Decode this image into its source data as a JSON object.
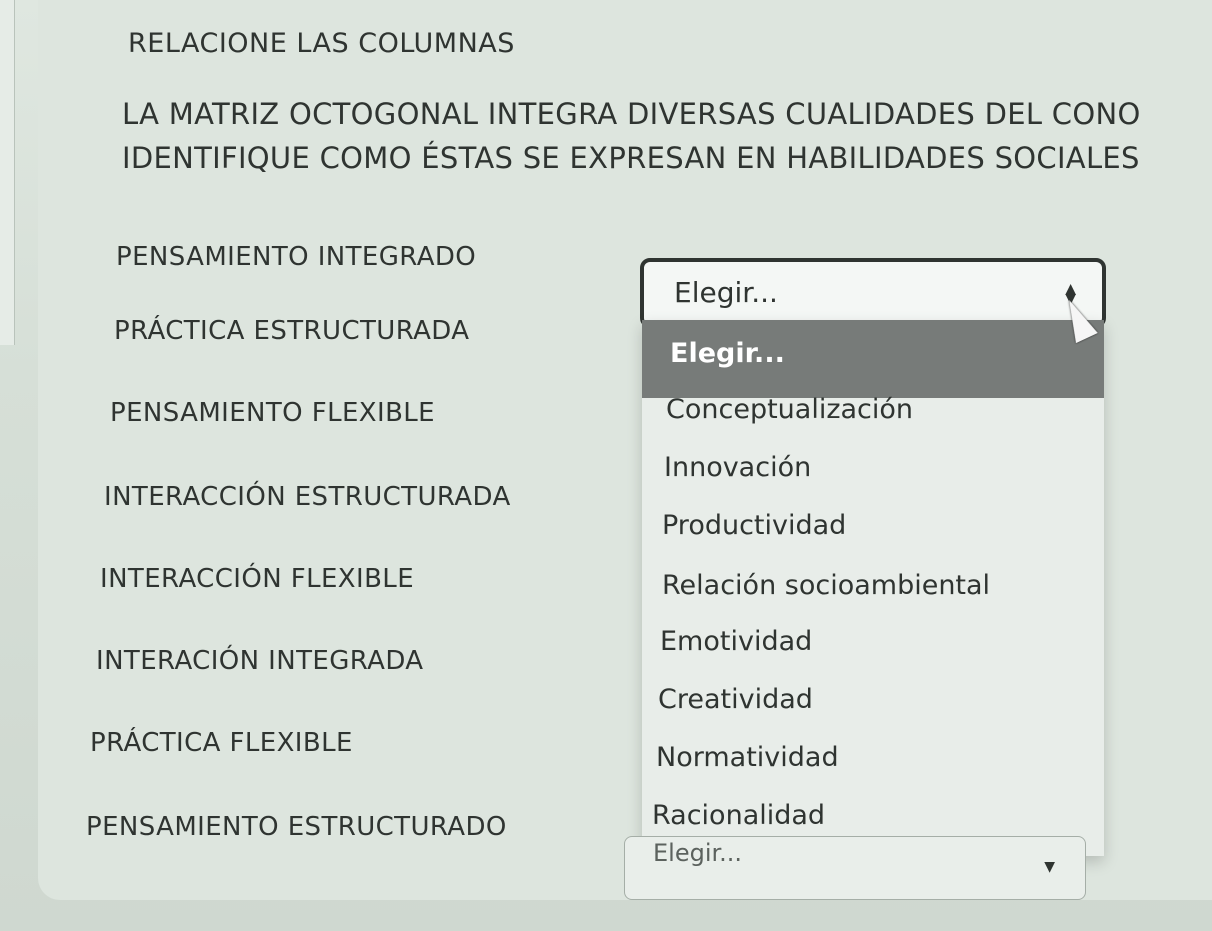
{
  "heading": "RELACIONE LAS COLUMNAS",
  "instructions": [
    "LA MATRIZ OCTOGONAL INTEGRA DIVERSAS CUALIDADES DEL CONO",
    "IDENTIFIQUE COMO ÉSTAS SE EXPRESAN EN HABILIDADES SOCIALES"
  ],
  "rows": [
    {
      "label": "PENSAMIENTO INTEGRADO"
    },
    {
      "label": "PRÁCTICA ESTRUCTURADA"
    },
    {
      "label": "PENSAMIENTO FLEXIBLE"
    },
    {
      "label": "INTERACCIÓN ESTRUCTURADA"
    },
    {
      "label": "INTERACCIÓN FLEXIBLE"
    },
    {
      "label": "INTERACIÓN INTEGRADA"
    },
    {
      "label": "PRÁCTICA FLEXIBLE"
    },
    {
      "label": "PENSAMIENTO ESTRUCTURADO"
    }
  ],
  "active_select": {
    "value": "Elegir..."
  },
  "dropdown_options": [
    "Elegir...",
    "Conceptualización",
    "Innovación",
    "Productividad",
    "Relación socioambiental",
    "Emotividad",
    "Creatividad",
    "Normatividad",
    "Racionalidad"
  ],
  "bottom_select": {
    "value": "Elegir..."
  },
  "icons": {
    "select_arrows": "up-down-arrows-icon",
    "cursor": "mouse-pointer-icon"
  }
}
